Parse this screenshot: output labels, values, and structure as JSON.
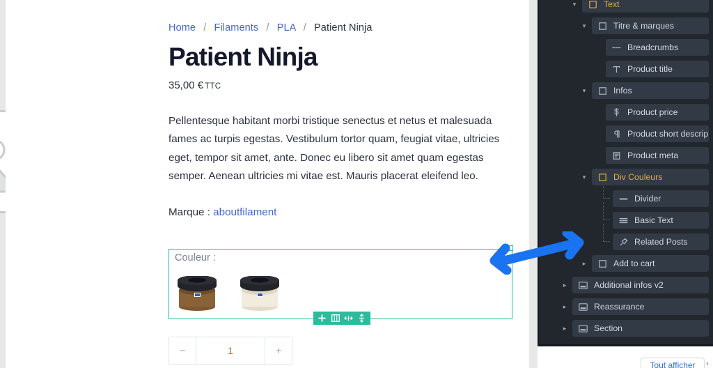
{
  "canvas": {
    "breadcrumb": {
      "items": [
        {
          "label": "Home",
          "link": true
        },
        {
          "label": "Filaments",
          "link": true
        },
        {
          "label": "PLA",
          "link": true
        },
        {
          "label": "Patient Ninja",
          "link": false
        }
      ],
      "separator": "/"
    },
    "product_title": "Patient Ninja",
    "price": "35,00 €",
    "price_tax_note": "TTC",
    "short_description": "Pellentesque habitant morbi tristique senectus et netus et malesuada fames ac turpis egestas. Vestibulum tortor quam, feugiat vitae, ultricies eget, tempor sit amet, ante. Donec eu libero sit amet quam egestas semper. Aenean ultricies mi vitae est. Mauris placerat eleifend leo.",
    "brand_label": "Marque :",
    "brand_value": "aboutfilament",
    "selected_block": {
      "label": "Couleur :",
      "swatches": [
        {
          "name": "filament-spool-wood",
          "color": "#8a6238"
        },
        {
          "name": "filament-spool-natural",
          "color": "#f2ecdf"
        }
      ]
    },
    "element_toolbar": {
      "buttons": [
        {
          "name": "add-element",
          "icon": "plus"
        },
        {
          "name": "columns-layout",
          "icon": "columns"
        },
        {
          "name": "resize-horizontal",
          "icon": "arrows-horizontal"
        },
        {
          "name": "resize-vertical",
          "icon": "arrows-vertical"
        }
      ]
    },
    "quantity": {
      "decrement": "−",
      "value": "1",
      "increment": "+"
    }
  },
  "panel": {
    "accent_selected": "#e3ae3c",
    "background": "#22272e",
    "rows": [
      {
        "label": "Text",
        "icon": "box",
        "depth": 1,
        "caret": "down",
        "selected": true,
        "partial": true
      },
      {
        "label": "Titre & marques",
        "icon": "box",
        "depth": 2,
        "caret": "down",
        "selected": false
      },
      {
        "label": "Breadcrumbs",
        "icon": "dashes",
        "depth": 3,
        "caret": "none",
        "selected": false
      },
      {
        "label": "Product title",
        "icon": "text-t",
        "depth": 3,
        "caret": "none",
        "selected": false
      },
      {
        "label": "Infos",
        "icon": "box",
        "depth": 2,
        "caret": "down",
        "selected": false
      },
      {
        "label": "Product price",
        "icon": "dollar",
        "depth": 3,
        "caret": "none",
        "selected": false
      },
      {
        "label": "Product short descrip",
        "icon": "pilcrow",
        "depth": 3,
        "caret": "none",
        "selected": false
      },
      {
        "label": "Product meta",
        "icon": "doc",
        "depth": 3,
        "caret": "none",
        "selected": false
      },
      {
        "label": "Div Couleurs",
        "icon": "box",
        "depth": 2,
        "caret": "down",
        "selected": true
      },
      {
        "label": "Divider",
        "icon": "minus",
        "depth": 4,
        "caret": "none",
        "selected": false
      },
      {
        "label": "Basic Text",
        "icon": "lines",
        "depth": 4,
        "caret": "none",
        "selected": false
      },
      {
        "label": "Related Posts",
        "icon": "pin",
        "depth": 4,
        "caret": "none",
        "selected": false
      },
      {
        "label": "Add to cart",
        "icon": "box",
        "depth": 2,
        "caret": "right",
        "selected": false
      },
      {
        "label": "Additional infos v2",
        "icon": "section",
        "depth": 0,
        "caret": "right",
        "selected": false
      },
      {
        "label": "Reassurance",
        "icon": "section",
        "depth": 0,
        "caret": "right",
        "selected": false
      },
      {
        "label": "Section",
        "icon": "section",
        "depth": 0,
        "caret": "right",
        "selected": false
      }
    ]
  },
  "footer": {
    "show_all_label": "Tout afficher"
  },
  "annotation": {
    "type": "double-arrow",
    "color": "#1a73f0"
  }
}
